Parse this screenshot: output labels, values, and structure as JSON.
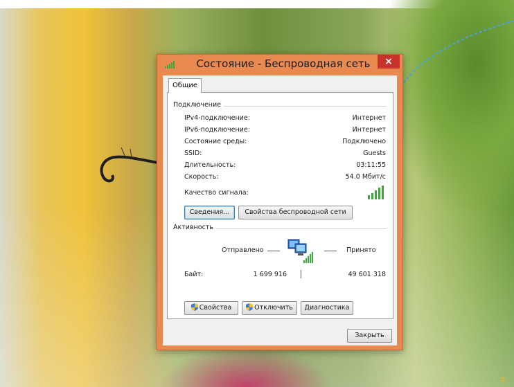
{
  "window": {
    "title": "Состояние - Беспроводная сеть",
    "close_glyph": "×",
    "tab": "Общие"
  },
  "connection": {
    "group_label": "Подключение",
    "rows": [
      {
        "label": "IPv4-подключение:",
        "value": "Интернет"
      },
      {
        "label": "IPv6-подключение:",
        "value": "Интернет"
      },
      {
        "label": "Состояние среды:",
        "value": "Подключено"
      },
      {
        "label": "SSID:",
        "value": "Guests"
      },
      {
        "label": "Длительность:",
        "value": "03:11:55"
      },
      {
        "label": "Скорость:",
        "value": "54.0 Мбит/с"
      }
    ],
    "signal_label": "Качество сигнала:",
    "signal_bars": 5,
    "details_button": "Сведения...",
    "wireless_props_button": "Свойства беспроводной сети"
  },
  "activity": {
    "group_label": "Активность",
    "sent_label": "Отправлено",
    "received_label": "Принято",
    "bytes_label": "Байт:",
    "sent_value": "1 699 916",
    "received_value": "49 601 318",
    "properties_button": "Свойства",
    "disable_button": "Отключить",
    "diagnostics_button": "Диагностика"
  },
  "close_button": "Закрыть",
  "icons": {
    "title": "signal-bars-icon",
    "signal": "signal-bars-icon",
    "network": "network-computer-icon",
    "shield": "uac-shield-icon"
  },
  "colors": {
    "window_frame": "#e8894f",
    "close_button": "#c7332c",
    "arrow": "#4aa3e0",
    "signal_green": "#3ea83a"
  }
}
